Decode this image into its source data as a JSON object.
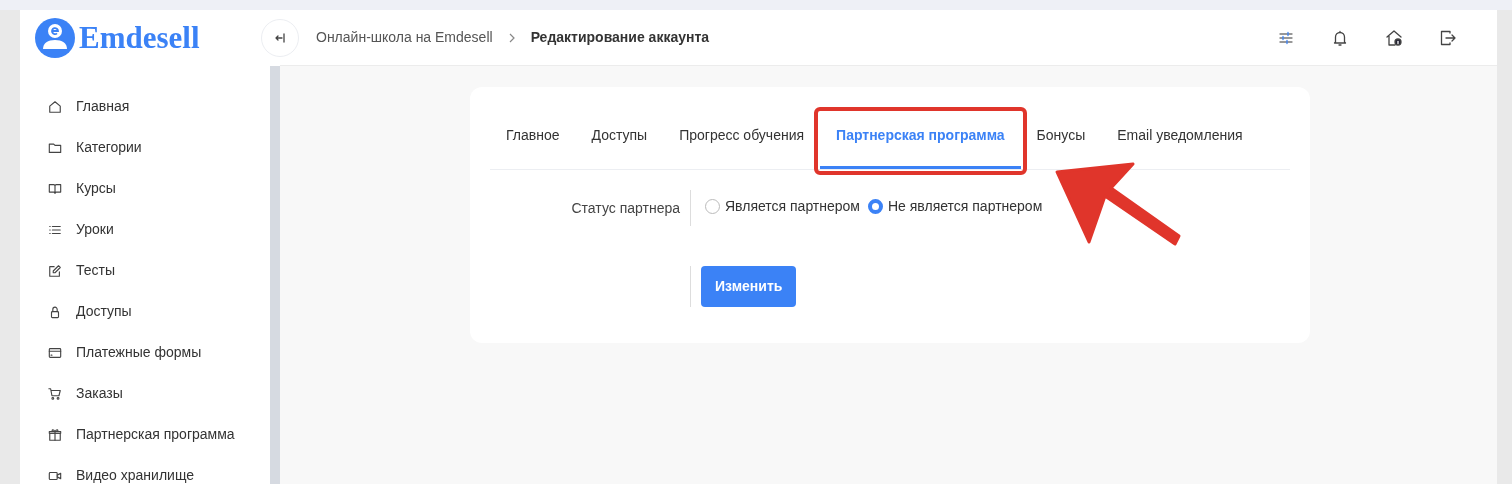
{
  "logo": {
    "text": "Emdesell"
  },
  "sidebar": {
    "items": [
      {
        "label": "Главная"
      },
      {
        "label": "Категории"
      },
      {
        "label": "Курсы"
      },
      {
        "label": "Уроки"
      },
      {
        "label": "Тесты"
      },
      {
        "label": "Доступы"
      },
      {
        "label": "Платежные формы"
      },
      {
        "label": "Заказы"
      },
      {
        "label": "Партнерская программа"
      },
      {
        "label": "Видео хранилище"
      }
    ]
  },
  "breadcrumb": [
    {
      "label": "Онлайн-школа на Emdesell",
      "current": false
    },
    {
      "label": "Редактирование аккаунта",
      "current": true
    }
  ],
  "tabs": [
    {
      "label": "Главное",
      "selected": false
    },
    {
      "label": "Доступы",
      "selected": false
    },
    {
      "label": "Прогресс обучения",
      "selected": false
    },
    {
      "label": "Партнерская программа",
      "selected": true
    },
    {
      "label": "Бонусы",
      "selected": false
    },
    {
      "label": "Email уведомления",
      "selected": false
    }
  ],
  "form": {
    "label": "Статус партнера",
    "options": [
      {
        "label": "Является партнером",
        "selected": false
      },
      {
        "label": "Не является партнером",
        "selected": true
      }
    ],
    "submit": "Изменить"
  }
}
